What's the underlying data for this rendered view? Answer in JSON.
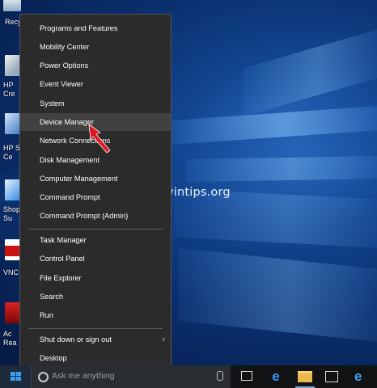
{
  "watermark": "www.wintips.org",
  "desktop_icons": [
    {
      "label": "Recy",
      "icon": "recycle-bin-icon"
    },
    {
      "label": "HP\nCre",
      "icon": "hp-create-icon"
    },
    {
      "label": "HP S\nCe",
      "icon": "hp-support-icon"
    },
    {
      "label": "Shop\nSu",
      "icon": "shop-icon"
    },
    {
      "label": "VNC",
      "icon": "vnc-icon"
    },
    {
      "label": "Ac\nRea",
      "icon": "acrobat-reader-icon"
    }
  ],
  "menu": {
    "group1": [
      "Programs and Features",
      "Mobility Center",
      "Power Options",
      "Event Viewer",
      "System",
      "Device Manager",
      "Network Connections",
      "Disk Management",
      "Computer Management",
      "Command Prompt",
      "Command Prompt (Admin)"
    ],
    "group2": [
      "Task Manager",
      "Control Panel",
      "File Explorer",
      "Search",
      "Run"
    ],
    "group3": [
      "Shut down or sign out",
      "Desktop"
    ],
    "highlighted": "Device Manager",
    "submenu_arrow": "›"
  },
  "taskbar": {
    "search_placeholder": "Ask me anything",
    "edge_glyph": "e",
    "ie_glyph": "e",
    "accent_color": "#3aa1f2"
  },
  "colors": {
    "menu_bg": "#2b2b2b",
    "menu_highlight": "#414141",
    "arrow_red": "#e0141e"
  }
}
